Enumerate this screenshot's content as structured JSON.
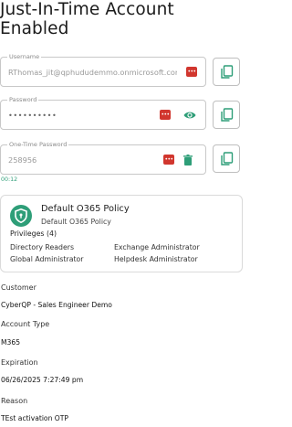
{
  "page": {
    "title": "Just-In-Time Account Enabled"
  },
  "username": {
    "label": "Username",
    "value": "RThomas_jit@qphududemmo.onmicrosoft.com"
  },
  "password": {
    "label": "Password",
    "value": "••••••••••"
  },
  "otp": {
    "label": "One-Time Password",
    "value": "258956",
    "timer": "00:12"
  },
  "icons": {
    "password_manager": "password-manager-icon",
    "copy": "copy-icon",
    "eye": "eye-icon",
    "trash": "trash-icon",
    "shield": "shield-icon"
  },
  "policy": {
    "name": "Default O365 Policy",
    "subtitle": "Default O365 Policy",
    "privileges_title": "Privileges (4)",
    "privileges": [
      "Directory Readers",
      "Exchange Administrator",
      "Global Administrator",
      "Helpdesk Administrator"
    ]
  },
  "details": {
    "customer_label": "Customer",
    "customer_value": "CyberQP - Sales Engineer Demo",
    "account_type_label": "Account Type",
    "account_type_value": "M365",
    "expiration_label": "Expiration",
    "expiration_value": "06/26/2025 7:27:49 pm",
    "reason_label": "Reason",
    "reason_value": "TEst activation OTP"
  },
  "colors": {
    "accent": "#2e9e78",
    "pw_manager": "#d1362e",
    "border": "#c8c8c8"
  }
}
